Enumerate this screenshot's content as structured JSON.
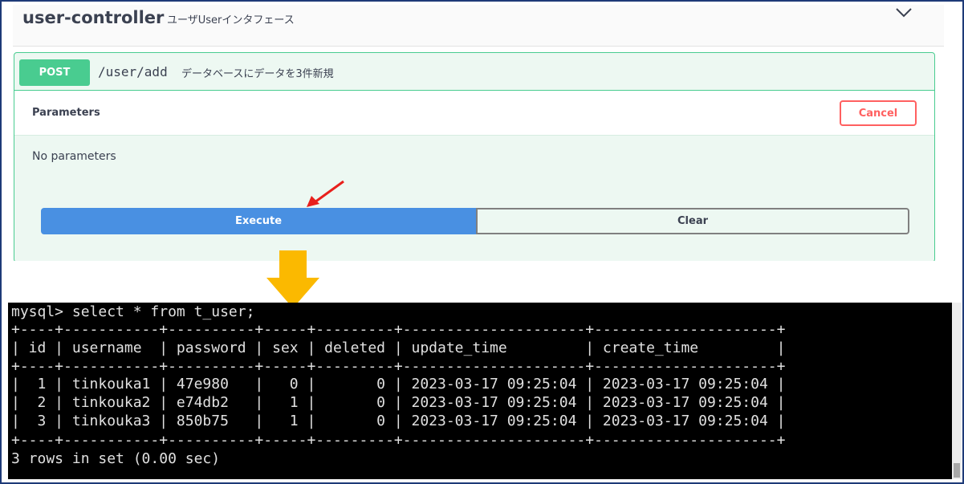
{
  "controller": {
    "title": "user-controller",
    "description": "ユーザUserインタフェース",
    "collapse_icon": "chevron-down-icon"
  },
  "operation": {
    "method": "POST",
    "path": "/user/add",
    "description": "データベースにデータを3件新規"
  },
  "parameters": {
    "title": "Parameters",
    "cancel_label": "Cancel",
    "empty_text": "No parameters"
  },
  "actions": {
    "execute_label": "Execute",
    "clear_label": "Clear"
  },
  "annotations": {
    "red_arrow": "arrow-pointer-icon",
    "down_arrow": "arrow-down-icon",
    "red_color": "#e8201c",
    "down_arrow_color": "#fbb900"
  },
  "terminal": {
    "command": "mysql> select * from t_user;",
    "separator": "+----+-----------+----------+-----+---------+---------------------+---------------------+",
    "header": "| id | username  | password | sex | deleted | update_time         | create_time         |",
    "rows": [
      "|  1 | tinkouka1 | 47e980   |   0 |       0 | 2023-03-17 09:25:04 | 2023-03-17 09:25:04 |",
      "|  2 | tinkouka2 | e74db2   |   1 |       0 | 2023-03-17 09:25:04 | 2023-03-17 09:25:04 |",
      "|  3 | tinkouka3 | 850b75   |   1 |       0 | 2023-03-17 09:25:04 | 2023-03-17 09:25:04 |"
    ],
    "result": "3 rows in set (0.00 sec)"
  },
  "colors": {
    "post_green": "#49cc90",
    "execute_blue": "#4990e2",
    "cancel_red": "#ff6060",
    "frame_border": "#1e3a78"
  }
}
